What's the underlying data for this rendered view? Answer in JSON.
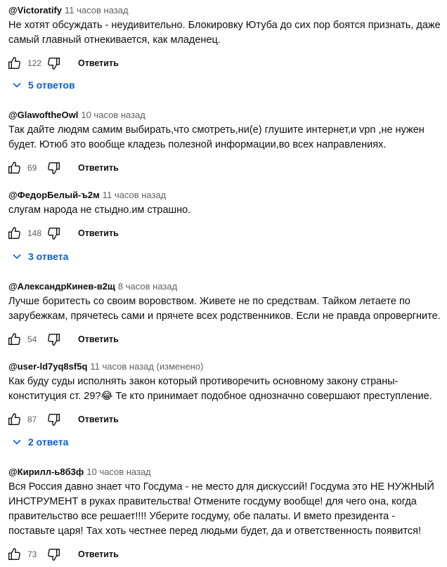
{
  "comments": [
    {
      "author": "@Victoratify",
      "time": "11 часов назад",
      "text": "Не хотят обсуждать - неудивительно. Блокировку Ютуба до сих пор боятся признать, даже самый главный отнекивается, как младенец.",
      "likes": "122",
      "reply_label": "Ответить",
      "replies_label": "5 ответов"
    },
    {
      "author": "@GlawoftheOwl",
      "time": "10 часов назад",
      "text": "Так дайте людям самим выбирать,что смотреть,ни(е) глушите интернет,и vpn ,не нужен будет. Ютюб это вообще кладезь полезной информации,во всех направлениях.",
      "likes": "69",
      "reply_label": "Ответить"
    },
    {
      "author": "@ФедорБелый-ъ2м",
      "time": "11 часов назад",
      "text": "слугам народа не стыдно.им страшно.",
      "likes": "148",
      "reply_label": "Ответить",
      "replies_label": "3 ответа"
    },
    {
      "author": "@АлександрКинев-в2щ",
      "time": "8 часов назад",
      "text": "Лучше боритесть со своим воровством. Живете не по средствам. Тайком летаете по зарубежкам, прячетесь  сами и прячете всех родственников. Если не правда опровергните.",
      "likes": "54",
      "reply_label": "Ответить"
    },
    {
      "author": "@user-ld7yq8sf5q",
      "time": "11 часов назад (изменено)",
      "text": "Как буду суды исполнять закон который противоречить основному закону страны- конституция ст. 29?😂  Те кто принимает подобное однозначно совершают преступление.",
      "likes": "87",
      "reply_label": "Ответить",
      "replies_label": "2 ответа"
    },
    {
      "author": "@Кирилл-ь8б3ф",
      "time": "10 часов назад",
      "text": "Вся Россия давно знает что Госдума - не место для дискуссий! Госдума это НЕ НУЖНЫЙ ИНСТРУМЕНТ в руках правительства! Отмените госдуму вообще! для чего она, когда правительство все решает!!!! Уберите госдуму, обе палаты. И вмето президента - поставьте царя! Тах хоть честнее перед людьми будет, да и ответственность появится!",
      "likes": "73",
      "reply_label": "Ответить"
    }
  ],
  "icons": {
    "like": "thumbs-up-icon",
    "dislike": "thumbs-down-icon",
    "expand": "chevron-down-icon"
  },
  "colors": {
    "link_blue": "#065fd4",
    "meta_gray": "#606060",
    "text": "#0f0f0f"
  }
}
